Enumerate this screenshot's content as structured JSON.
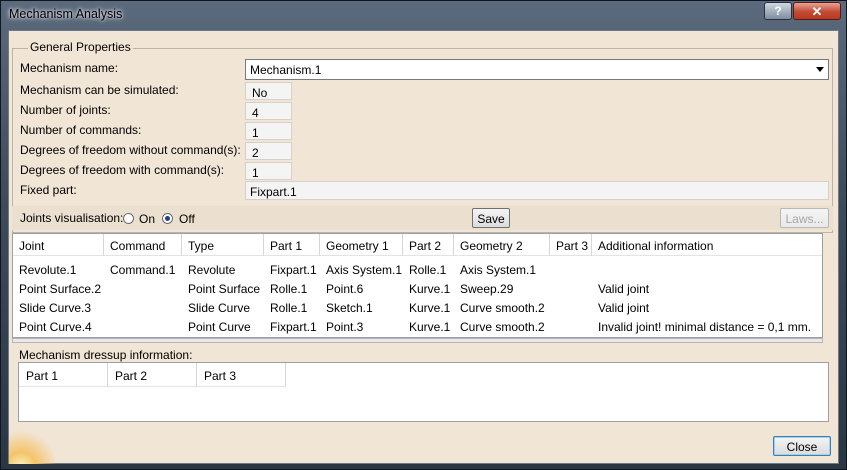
{
  "window": {
    "title": "Mechanism Analysis",
    "help_label": "?",
    "close_label": "✕"
  },
  "general": {
    "legend": "General Properties",
    "mechanism_name_label": "Mechanism name:",
    "mechanism_name_value": "Mechanism.1",
    "can_simulate_label": "Mechanism can be simulated:",
    "can_simulate_value": "No",
    "joints_label": "Number of joints:",
    "joints_value": "4",
    "commands_label": "Number of commands:",
    "commands_value": "1",
    "dof_without_label": "Degrees of freedom without command(s):",
    "dof_without_value": "2",
    "dof_with_label": "Degrees of freedom with command(s):",
    "dof_with_value": "1",
    "fixed_part_label": "Fixed part:",
    "fixed_part_value": "Fixpart.1"
  },
  "visualisation": {
    "label": "Joints visualisation:",
    "on_label": "On",
    "off_label": "Off",
    "selected": "Off",
    "save_label": "Save",
    "laws_label": "Laws..."
  },
  "joints_table": {
    "headers": [
      "Joint",
      "Command",
      "Type",
      "Part 1",
      "Geometry 1",
      "Part 2",
      "Geometry 2",
      "Part 3",
      "Additional information"
    ],
    "rows": [
      [
        "Revolute.1",
        "Command.1",
        "Revolute",
        "Fixpart.1",
        "Axis System.1",
        "Rolle.1",
        "Axis System.1",
        "",
        ""
      ],
      [
        "Point Surface.2",
        "",
        "Point Surface",
        "Rolle.1",
        "Point.6",
        "Kurve.1",
        "Sweep.29",
        "",
        "Valid joint"
      ],
      [
        "Slide Curve.3",
        "",
        "Slide Curve",
        "Rolle.1",
        "Sketch.1",
        "Kurve.1",
        "Curve smooth.2",
        "",
        "Valid joint"
      ],
      [
        "Point Curve.4",
        "",
        "Point Curve",
        "Fixpart.1",
        "Point.3",
        "Kurve.1",
        "Curve smooth.2",
        "",
        "Invalid joint! minimal distance = 0,1 mm."
      ]
    ]
  },
  "dressup": {
    "label": "Mechanism dressup information:",
    "headers": [
      "Part 1",
      "Part 2",
      "Part 3"
    ]
  },
  "footer": {
    "close_label": "Close"
  }
}
